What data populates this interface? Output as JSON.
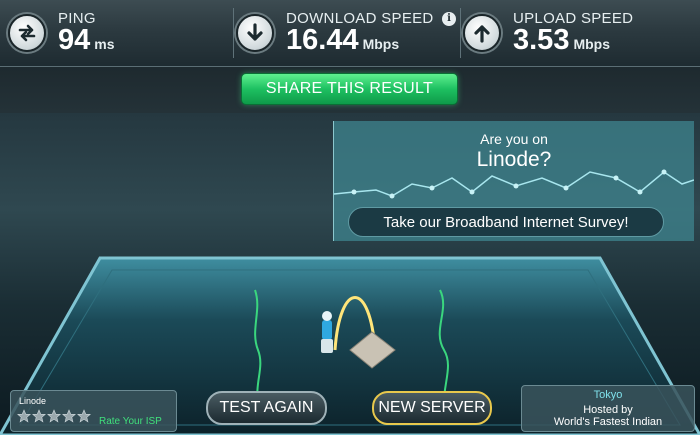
{
  "stats": {
    "ping": {
      "label": "PING",
      "value": "94",
      "unit": "ms",
      "icon": "ping-arrows-icon"
    },
    "download": {
      "label": "DOWNLOAD SPEED",
      "value": "16.44",
      "unit": "Mbps",
      "icon": "download-arrow-icon"
    },
    "upload": {
      "label": "UPLOAD SPEED",
      "value": "3.53",
      "unit": "Mbps",
      "icon": "upload-arrow-icon"
    }
  },
  "share": {
    "label": "SHARE THIS RESULT"
  },
  "survey": {
    "question": "Are you on",
    "isp": "Linode?",
    "button": "Take our Broadband Internet Survey!"
  },
  "isp_rating": {
    "isp_name": "Linode",
    "rate_label": "Rate Your ISP",
    "stars_total": 5,
    "stars_filled": 0
  },
  "actions": {
    "test_again": "TEST AGAIN",
    "new_server": "NEW SERVER"
  },
  "server": {
    "city": "Tokyo",
    "hosted_by_label": "Hosted by",
    "host": "World's Fastest Indian"
  },
  "colors": {
    "share_green": "#1ec061",
    "new_server_border": "#e8c84c",
    "accent_cyan": "#40d7ea"
  }
}
